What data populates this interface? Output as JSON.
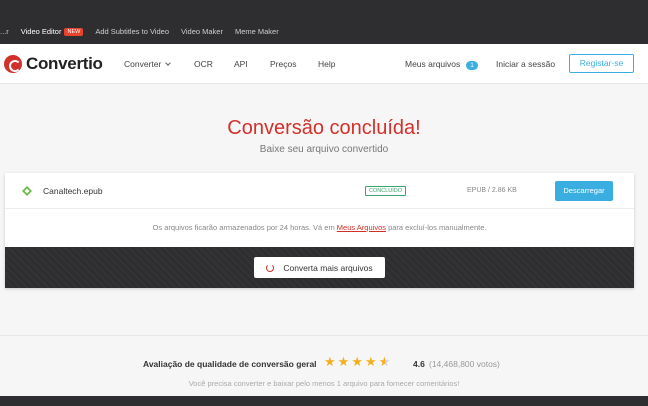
{
  "topbar": {
    "links": [
      "...r",
      "Video Editor",
      "Add Subtitles to Video",
      "Video Maker",
      "Meme Maker"
    ],
    "new_badge": "NEW"
  },
  "nav": {
    "brand": "Convertio",
    "items": [
      "Converter",
      "OCR",
      "API",
      "Preços",
      "Help"
    ],
    "my_files": "Meus arquivos",
    "my_files_count": "1",
    "login": "Iniciar a sessão",
    "register": "Registar-se"
  },
  "main": {
    "title": "Conversão concluída!",
    "subtitle": "Baixe seu arquivo convertido"
  },
  "file": {
    "name": "Canaltech.epub",
    "status": "CONCLUÍDO",
    "info": "EPUB / 2.86 KB",
    "download_label": "Descarregar"
  },
  "storage_note": {
    "before": "Os arquivos ficarão armazenados por 24 horas. Vá em ",
    "link": "Meus Arquivos",
    "after": " para excluí-los manualmente."
  },
  "convert_more": "Converta mais arquivos",
  "rating": {
    "label": "Avaliação de qualidade de conversão geral",
    "value": "4.6",
    "value_numeric": 4.6,
    "max": 5,
    "votes": "(14,468,800 votos)",
    "note": "Você precisa converter e baixar pelo menos 1 arquivo para fornecer comentários!"
  },
  "colors": {
    "brand_red": "#d1312a",
    "accent_blue": "#3aaee0",
    "dark_bar": "#2e2e30",
    "star": "#f2b01e",
    "status_green": "#3ea36e"
  }
}
